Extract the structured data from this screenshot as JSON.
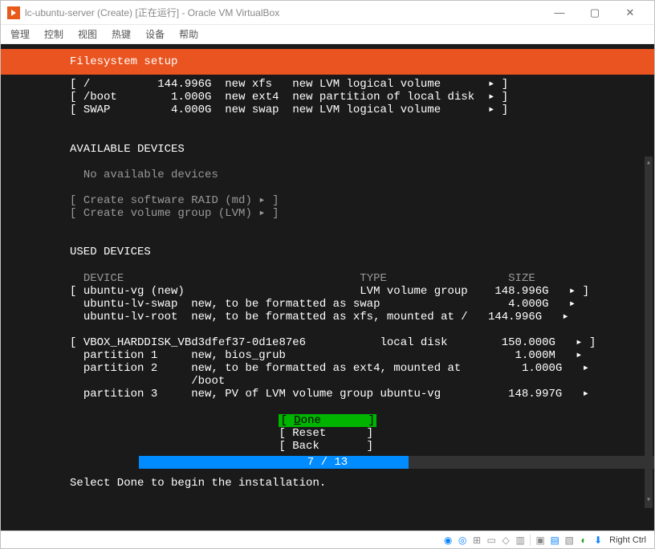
{
  "window": {
    "title": "lc-ubuntu-server (Create) [正在运行] - Oracle VM VirtualBox",
    "controls": {
      "minimize": "—",
      "maximize": "▢",
      "close": "✕"
    }
  },
  "menubar": [
    "管理",
    "控制",
    "视图",
    "热键",
    "设备",
    "帮助"
  ],
  "header": "Filesystem setup",
  "file_systems": [
    {
      "mount": "/",
      "size": "144.996G",
      "fs": "new xfs",
      "desc": "new LVM logical volume",
      "arrow": "▸"
    },
    {
      "mount": "/boot",
      "size": "1.000G",
      "fs": "new ext4",
      "desc": "new partition of local disk",
      "arrow": "▸"
    },
    {
      "mount": "SWAP",
      "size": "4.000G",
      "fs": "new swap",
      "desc": "new LVM logical volume",
      "arrow": "▸"
    }
  ],
  "sections": {
    "available_heading": "AVAILABLE DEVICES",
    "no_available": "No available devices",
    "create_raid": "Create software RAID (md)",
    "create_vg": "Create volume group (LVM)",
    "used_heading": "USED DEVICES",
    "cols": {
      "device": "DEVICE",
      "type": "TYPE",
      "size": "SIZE"
    }
  },
  "used": {
    "vg": {
      "name": "ubuntu-vg (new)",
      "type": "LVM volume group",
      "size": "148.996G",
      "arrow": "▸"
    },
    "lv1": {
      "name": "ubuntu-lv-swap",
      "desc": "new, to be formatted as swap",
      "size": "4.000G",
      "arrow": "▸"
    },
    "lv2": {
      "name": "ubuntu-lv-root",
      "desc": "new, to be formatted as xfs, mounted at /",
      "size": "144.996G",
      "arrow": "▸"
    },
    "disk": {
      "name": "VBOX_HARDDISK_VBd3dfef37-0d1e87e6",
      "type": "local disk",
      "size": "150.000G",
      "arrow": "▸"
    },
    "p1": {
      "name": "partition 1",
      "desc": "new, bios_grub",
      "size": "1.000M",
      "arrow": "▸"
    },
    "p2": {
      "name": "partition 2",
      "desc": "new, to be formatted as ext4, mounted at",
      "desc2": "/boot",
      "size": "1.000G",
      "arrow": "▸"
    },
    "p3": {
      "name": "partition 3",
      "desc": "new, PV of LVM volume group ubuntu-vg",
      "size": "148.997G",
      "arrow": "▸"
    }
  },
  "actions": {
    "done": "[ Done       ]",
    "reset": "[ Reset      ]",
    "back": "[ Back       ]"
  },
  "progress": {
    "text": "7 / 13"
  },
  "hint": "Select Done to begin the installation.",
  "statusbar": {
    "host_key": "Right Ctrl"
  }
}
